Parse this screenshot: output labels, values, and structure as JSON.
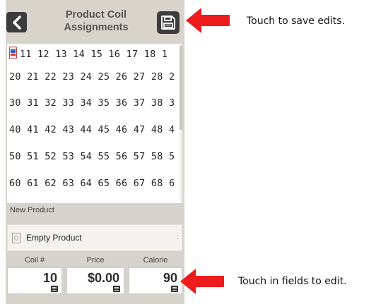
{
  "header": {
    "title": "Product Coil\nAssignments",
    "back_icon": "chevron-left-icon",
    "save_icon": "save-disk-icon"
  },
  "grid": {
    "rows": [
      [
        "11",
        "12",
        "13",
        "14",
        "15",
        "16",
        "17",
        "18",
        "1"
      ],
      [
        "20",
        "21",
        "22",
        "23",
        "24",
        "25",
        "26",
        "27",
        "28",
        "2"
      ],
      [
        "30",
        "31",
        "32",
        "33",
        "34",
        "35",
        "36",
        "37",
        "38",
        "3"
      ],
      [
        "40",
        "41",
        "42",
        "43",
        "44",
        "45",
        "46",
        "47",
        "48",
        "4"
      ],
      [
        "50",
        "51",
        "52",
        "53",
        "54",
        "55",
        "56",
        "57",
        "58",
        "5"
      ],
      [
        "60",
        "61",
        "62",
        "63",
        "64",
        "65",
        "66",
        "67",
        "68",
        "6"
      ]
    ],
    "first_cell_icon": "soda-can-icon"
  },
  "new_product": {
    "label": "New Product",
    "selected": "Empty Product",
    "caret": ":"
  },
  "fields": [
    {
      "label": "Coil #",
      "value": "10"
    },
    {
      "label": "Price",
      "value": "$0.00"
    },
    {
      "label": "Calorie",
      "value": "90"
    }
  ],
  "callouts": {
    "save": "Touch to save edits.",
    "edit": "Touch in fields to edit."
  },
  "colors": {
    "arrow": "#ee1c1c",
    "header_bg": "#d8d4cc",
    "icon_button": "#3c3c3c"
  }
}
